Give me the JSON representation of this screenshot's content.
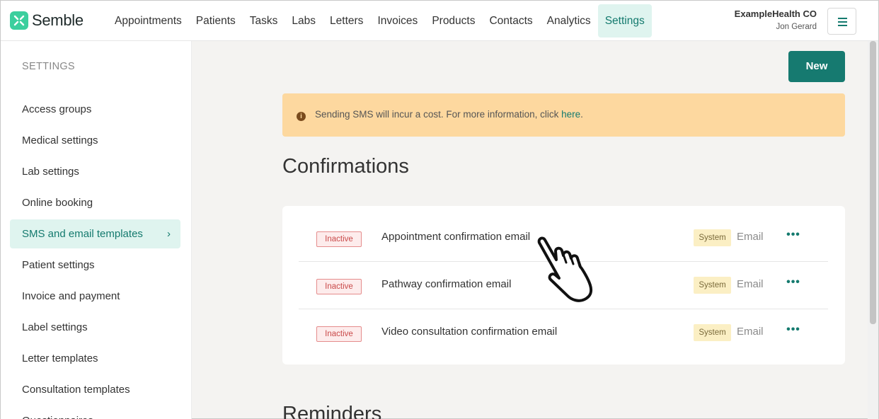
{
  "header": {
    "brand": "Semble",
    "nav": [
      "Appointments",
      "Patients",
      "Tasks",
      "Labs",
      "Letters",
      "Invoices",
      "Products",
      "Contacts",
      "Analytics",
      "Settings"
    ],
    "active_nav": "Settings",
    "org_name": "ExampleHealth CO",
    "user_name": "Jon Gerard",
    "menu_icon": "hamburger-icon"
  },
  "sidebar": {
    "title": "SETTINGS",
    "items": [
      {
        "label": "Access groups"
      },
      {
        "label": "Medical settings"
      },
      {
        "label": "Lab settings"
      },
      {
        "label": "Online booking"
      },
      {
        "label": "SMS and email templates",
        "active": true,
        "chevron": "›"
      },
      {
        "label": "Patient settings"
      },
      {
        "label": "Invoice and payment"
      },
      {
        "label": "Label settings"
      },
      {
        "label": "Letter templates"
      },
      {
        "label": "Consultation templates"
      },
      {
        "label": "Questionnaires"
      }
    ]
  },
  "main": {
    "new_button": "New",
    "alert": {
      "text": "Sending SMS will incur a cost. For more information, click ",
      "link": "here",
      "suffix": ".",
      "icon": "info-icon"
    },
    "confirmations": {
      "title": "Confirmations",
      "rows": [
        {
          "status": "Inactive",
          "name": "Appointment confirmation email",
          "badge": "System",
          "channel": "Email",
          "more": "•••"
        },
        {
          "status": "Inactive",
          "name": "Pathway confirmation email",
          "badge": "System",
          "channel": "Email",
          "more": "•••"
        },
        {
          "status": "Inactive",
          "name": "Video consultation confirmation email",
          "badge": "System",
          "channel": "Email",
          "more": "•••"
        }
      ]
    },
    "reminders": {
      "title": "Reminders"
    }
  },
  "colors": {
    "accent": "#167a70",
    "active_bg": "#dff4ef",
    "alert_bg": "#fdd89f",
    "inactive": "#c94a4a",
    "system_badge": "#fbefc4"
  }
}
